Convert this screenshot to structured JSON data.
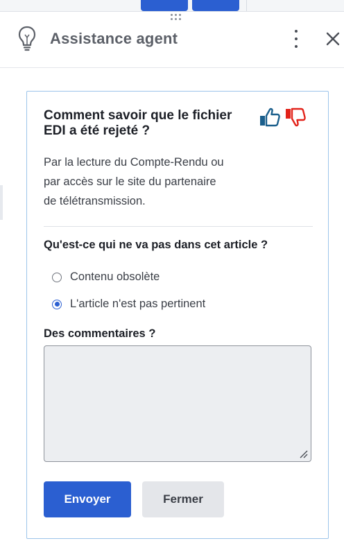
{
  "header": {
    "title": "Assistance agent",
    "icon": "lightbulb-icon"
  },
  "article": {
    "question": "Comment savoir que le fichier EDI a été rejeté ?",
    "answer_lines": [
      "Par la lecture du Compte-Rendu ou",
      "par accès sur le site du partenaire",
      "de télétransmission."
    ]
  },
  "feedback": {
    "question": "Qu'est-ce qui ne va pas dans cet article ?",
    "options": [
      {
        "label": "Contenu obsolète",
        "selected": false
      },
      {
        "label": "L'article n'est pas pertinent",
        "selected": true
      }
    ],
    "comments_label": "Des commentaires ?",
    "comments_value": ""
  },
  "buttons": {
    "send": "Envoyer",
    "close": "Fermer"
  },
  "colors": {
    "accent": "#2b5fd1",
    "thumb_up": "#1b5f8c",
    "thumb_down": "#e2231a"
  }
}
